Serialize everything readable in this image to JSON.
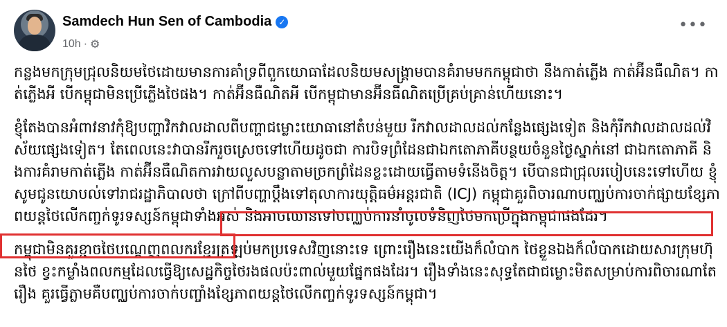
{
  "post": {
    "author": "Samdech Hun Sen of Cambodia",
    "verified_icon": "verified-badge-icon",
    "time": "10h",
    "privacy_icon": "gear-icon",
    "more_label": "•••",
    "paragraphs": [
      "កន្លងមកក្រុមជ្រុលនិយមថៃដោយមានការគាំទ្រពីពួកយោធាដែលនិយមសង្គ្រាមបានគំរាមមកកម្ពុជាថា នឹងកាត់ភ្លើង កាត់អ៊ីនធឺណិត។ កាត់ភ្លើងអី បើកម្ពុជាមិនប្រើភ្លើងថៃផង។ កាត់អ៊ីនធឺណិតអី បើកម្ពុជាមានអ៊ីនធឺណិតប្រើគ្រប់គ្រាន់ហើយនោះ។",
      "ខ្ញុំតែងបានអំពាវនាវកុំឱ្យបញ្ហាវិកវាលដាលពីបញ្ហាជម្លោះយោធានៅតំបន់មួយ រីកវាលដាលដល់កន្លែងផ្សេងទៀត និងកុំរីកវាលដាលដល់វិស័យផ្សេងទៀត។ តែពេលនេះវាបានរីករួចស្រេចទៅហើយដូចជា ការបិទព្រំដែនជាឯកតោភាគីបន្ថយចំនួនថ្ងៃស្នាក់នៅ ជាឯកតោភាគី និងការគំរាមកាត់ភ្លើង កាត់អ៊ីនធឺណិតការវាយលួសបន្លាតាមច្រកព្រំដែនខ្លះដោយធ្វើតាមទំនើងចិត្ត។ បើបានជាជ្រុលរបៀបនេះទៅហើយ ខ្ញុំសូមជូនយោបល់ទៅរាជរដ្ឋាភិបាលថា ក្រៅពីបញ្ហាប្តឹងទៅតុលាការយុត្តិធម៌អន្តរជាតិ (ICJ) កម្ពុជាគួរពិចារណាបញ្ឈប់ការចាក់ផ្សាយខ្សែភាពយន្តថៃលើកញ្ចក់ទូរទស្សន៍កម្ពុជាទាំងអស់ និងអាចឈានទៅបញ្ឈប់ការនាំចូលទំនិញថៃមកប្រើក្នុងកម្ពុជាផងដែរ។",
      "កម្ពុជាមិនគួរខ្ជាចថៃបណ្តេញពលករខ្មែរត្រឡប់មកប្រទេសវិញនោះទេ ព្រោះរឿងនេះយើងក៏លំបាក ថៃខ្លួនឯងក៏លំបាកដោយសារក្រុមហ៊ុនថៃ ខ្វះកម្លាំងពលកម្មដែលធ្វើឱ្យសេដ្ឋកិច្ចថៃរងផលប៉ះពាល់មួយផ្នែកផងដែរ។ រឿងទាំងនេះសុទ្ធតែជាជម្លោះមិតសម្រាប់ការពិចារណាតែរឿង គួរធ្វើភ្លាមគឺបញ្ឈប់ការចាក់បញ្ចាំងខ្សែភាពយន្តថៃលើកញ្ចក់ទូរទស្សន៍កម្ពុជា។"
    ]
  }
}
